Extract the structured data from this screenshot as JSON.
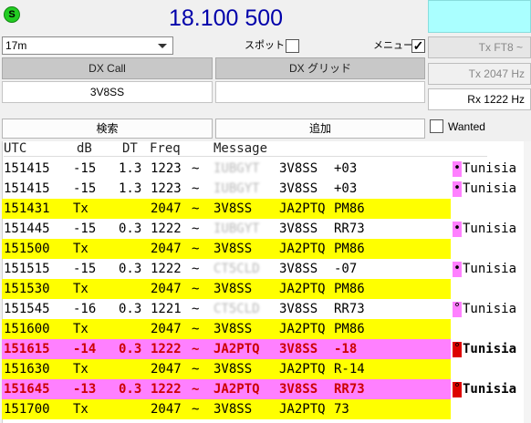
{
  "top": {
    "status_indicator": "S",
    "frequency": "18.100 500"
  },
  "band": {
    "selected": "17m"
  },
  "options": {
    "spot_label": "スポット",
    "spot_checked": false,
    "menu_label": "メニュー",
    "menu_checked": true
  },
  "tx_mode": "Tx FT8 ~",
  "tx_freq": "Tx  2047  Hz",
  "rx_freq": "Rx  1222  Hz",
  "dx": {
    "call_header": "DX Call",
    "grid_header": "DX グリッド",
    "call_value": "3V8SS",
    "grid_value": ""
  },
  "buttons": {
    "search": "検索",
    "add": "追加",
    "wanted_label": "Wanted"
  },
  "columns": {
    "utc": "UTC",
    "db": "dB",
    "dt": "DT",
    "freq": "Freq",
    "message": "Message"
  },
  "rows": [
    {
      "utc": "151415",
      "db": "-15",
      "dt": "1.3",
      "freq": "1223",
      "sep": "~",
      "call1": "IUBGYT",
      "call2": "3V8SS",
      "extra": "+03",
      "kind": "rx",
      "marker": "•",
      "country": "Tunisia"
    },
    {
      "utc": "151415",
      "db": "-15",
      "dt": "1.3",
      "freq": "1223",
      "sep": "~",
      "call1": "IUBGYT",
      "call2": "3V8SS",
      "extra": "+03",
      "kind": "rx",
      "marker": "•",
      "country": "Tunisia"
    },
    {
      "utc": "151431",
      "db": "Tx",
      "dt": "",
      "freq": "2047",
      "sep": "~",
      "call1": "3V8SS",
      "call2": "JA2PTQ",
      "extra": "PM86",
      "kind": "tx",
      "marker": "",
      "country": ""
    },
    {
      "utc": "151445",
      "db": "-15",
      "dt": "0.3",
      "freq": "1222",
      "sep": "~",
      "call1": "IUBGYT",
      "call2": "3V8SS",
      "extra": "RR73",
      "kind": "rx",
      "marker": "•",
      "country": "Tunisia"
    },
    {
      "utc": "151500",
      "db": "Tx",
      "dt": "",
      "freq": "2047",
      "sep": "~",
      "call1": "3V8SS",
      "call2": "JA2PTQ",
      "extra": "PM86",
      "kind": "tx",
      "marker": "",
      "country": ""
    },
    {
      "utc": "151515",
      "db": "-15",
      "dt": "0.3",
      "freq": "1222",
      "sep": "~",
      "call1": "CT5CLD",
      "call2": "3V8SS",
      "extra": "-07",
      "kind": "rx",
      "marker": "•",
      "country": "Tunisia"
    },
    {
      "utc": "151530",
      "db": "Tx",
      "dt": "",
      "freq": "2047",
      "sep": "~",
      "call1": "3V8SS",
      "call2": "JA2PTQ",
      "extra": "PM86",
      "kind": "tx",
      "marker": "",
      "country": ""
    },
    {
      "utc": "151545",
      "db": "-16",
      "dt": "0.3",
      "freq": "1221",
      "sep": "~",
      "call1": "CT5CLD",
      "call2": "3V8SS",
      "extra": "RR73",
      "kind": "rx",
      "marker": "°",
      "country": "Tunisia"
    },
    {
      "utc": "151600",
      "db": "Tx",
      "dt": "",
      "freq": "2047",
      "sep": "~",
      "call1": "3V8SS",
      "call2": "JA2PTQ",
      "extra": "PM86",
      "kind": "tx",
      "marker": "",
      "country": ""
    },
    {
      "utc": "151615",
      "db": "-14",
      "dt": "0.3",
      "freq": "1222",
      "sep": "~",
      "call1": "JA2PTQ",
      "call2": "3V8SS",
      "extra": "-18",
      "kind": "hl",
      "marker": "°",
      "country": "Tunisia"
    },
    {
      "utc": "151630",
      "db": "Tx",
      "dt": "",
      "freq": "2047",
      "sep": "~",
      "call1": "3V8SS",
      "call2": "JA2PTQ",
      "extra": "R-14",
      "kind": "tx",
      "marker": "",
      "country": ""
    },
    {
      "utc": "151645",
      "db": "-13",
      "dt": "0.3",
      "freq": "1222",
      "sep": "~",
      "call1": "JA2PTQ",
      "call2": "3V8SS",
      "extra": "RR73",
      "kind": "hl",
      "marker": "°",
      "country": "Tunisia"
    },
    {
      "utc": "151700",
      "db": "Tx",
      "dt": "",
      "freq": "2047",
      "sep": "~",
      "call1": "3V8SS",
      "call2": "JA2PTQ",
      "extra": "73",
      "kind": "tx",
      "marker": "",
      "country": ""
    }
  ],
  "colors": {
    "tx_row": "#ffff00",
    "highlight_row": "#ff80ff",
    "highlight_text": "#cc0000",
    "frequency_text": "#0000aa",
    "status_green": "#22cc22",
    "cyan_panel": "#aaffff"
  }
}
